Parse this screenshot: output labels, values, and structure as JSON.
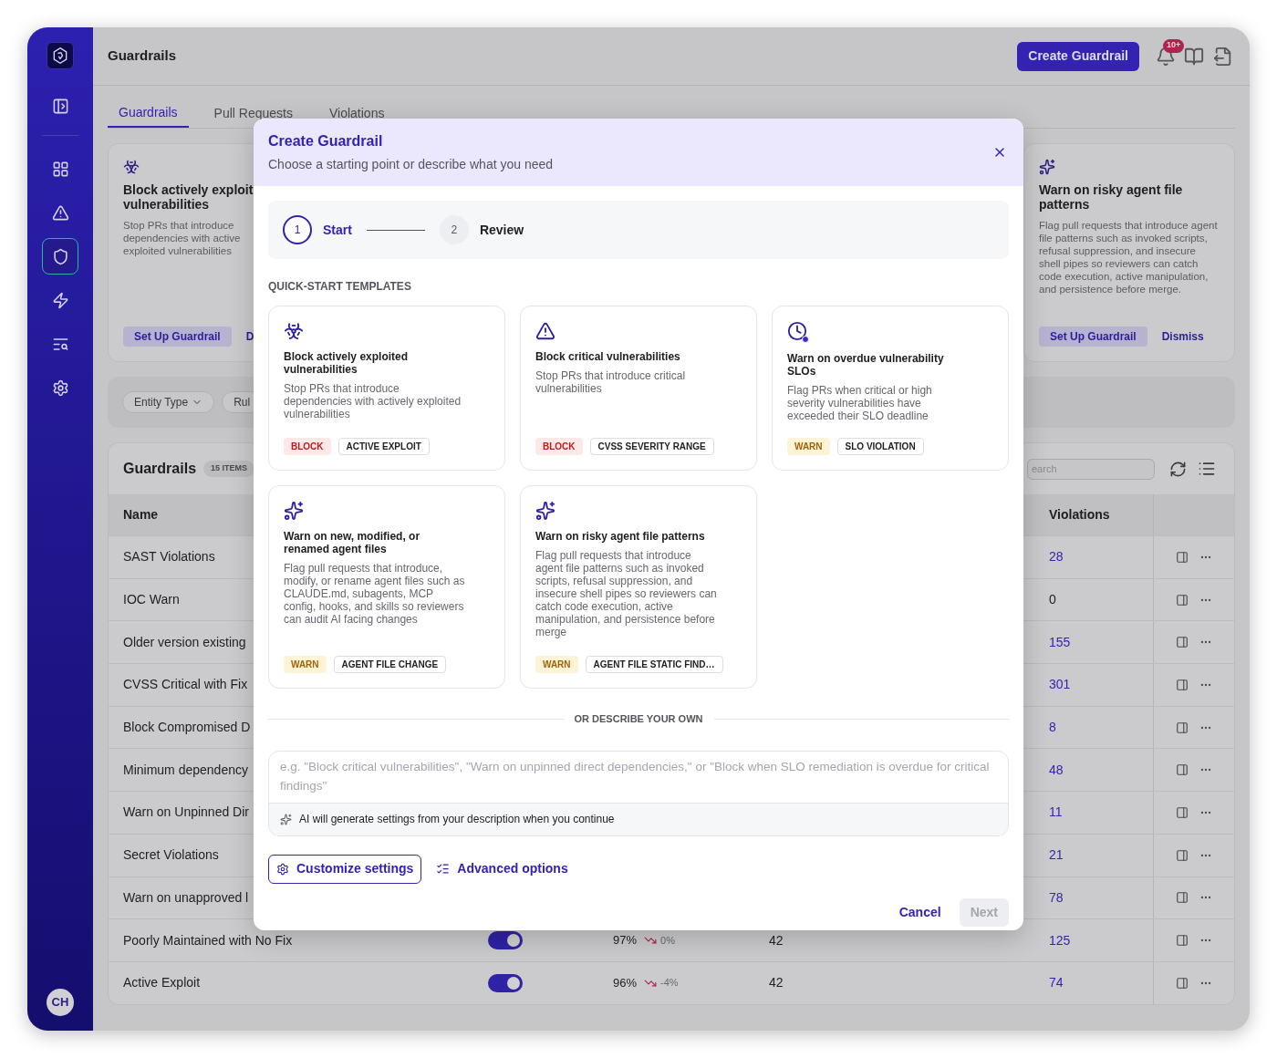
{
  "sidebar": {
    "items": [
      {
        "selected": false
      },
      {
        "selected": false
      },
      {
        "selected": false
      },
      {
        "selected": true
      },
      {
        "selected": false
      },
      {
        "selected": false
      },
      {
        "selected": false
      }
    ],
    "avatar": "CH"
  },
  "header": {
    "title": "Guardrails",
    "create_button": "Create Guardrail",
    "notification_badge": "10+"
  },
  "tabs": [
    {
      "label": "Guardrails",
      "selected": true
    },
    {
      "label": "Pull Requests",
      "selected": false
    },
    {
      "label": "Violations",
      "selected": false
    }
  ],
  "promo_cards": [
    {
      "kind": "exploit",
      "title": "Block actively exploit\nvulnerabilities",
      "description": "Stop PRs that introduce\ndependencies with active\nexploited vulnerabilities",
      "setup_button": "Set Up Guardrail",
      "dismiss_button": "D"
    },
    {
      "kind": "agent",
      "title": "Warn on risky agent file patterns",
      "description": "Flag pull requests that introduce agent file patterns such as invoked scripts, refusal suppression, and insecure shell pipes so reviewers can catch code execution, active manipulation, and persistence before merge.",
      "setup_button": "Set Up Guardrail",
      "dismiss_button": "Dismiss"
    }
  ],
  "filters": [
    {
      "label": "Entity Type",
      "kind": "dropdown"
    },
    {
      "label": "Rul",
      "kind": "plain"
    }
  ],
  "table": {
    "title": "Guardrails",
    "count": "15 ITEMS",
    "search": {
      "placeholder": "earch"
    },
    "columns": [
      "Name",
      "Violations"
    ],
    "rows": [
      {
        "name": "SAST Violations",
        "violations": "28",
        "link": true
      },
      {
        "name": "IOC Warn",
        "violations": "0",
        "link": false
      },
      {
        "name": "Older version existing",
        "violations": "155",
        "link": true
      },
      {
        "name": "CVSS Critical with Fix",
        "violations": "301",
        "link": true
      },
      {
        "name": "Block Compromised D",
        "violations": "8",
        "link": true
      },
      {
        "name": "Minimum dependency",
        "violations": "48",
        "link": true
      },
      {
        "name": "Warn on Unpinned Dir",
        "violations": "11",
        "link": true
      },
      {
        "name": "Secret Violations",
        "violations": "21",
        "link": true
      },
      {
        "name": "Warn on unapproved l",
        "violations": "78",
        "link": true
      },
      {
        "name": "Poorly Maintained with No Fix",
        "enabled": true,
        "score": "97%",
        "trend": "0%",
        "count": "42",
        "violations": "125",
        "link": true
      },
      {
        "name": "Active Exploit",
        "enabled": true,
        "score": "96%",
        "trend": "-4%",
        "count": "42",
        "violations": "74",
        "link": true
      }
    ]
  },
  "modal": {
    "title": "Create Guardrail",
    "subtitle": "Choose a starting point or describe what you need",
    "steps": [
      {
        "number": "1",
        "label": "Start",
        "selected": true
      },
      {
        "number": "2",
        "label": "Review",
        "selected": false
      }
    ],
    "section_label": "QUICK-START TEMPLATES",
    "templates": [
      {
        "kind": "exploit",
        "title": "Block actively exploited vulnerabilities",
        "description": "Stop PRs that introduce dependencies with actively exploited vulnerabilities",
        "action": {
          "label": "BLOCK",
          "kind": "block"
        },
        "category": "ACTIVE EXPLOIT"
      },
      {
        "kind": "severity",
        "title": "Block critical vulnerabilities",
        "description": "Stop PRs that introduce critical vulnerabilities",
        "action": {
          "label": "BLOCK",
          "kind": "block"
        },
        "category": "CVSS SEVERITY RANGE"
      },
      {
        "kind": "slo",
        "title": "Warn on overdue vulnerability SLOs",
        "description": "Flag PRs when critical or high severity vulnerabilities have exceeded their SLO deadline",
        "action": {
          "label": "WARN",
          "kind": "warn"
        },
        "category": "SLO VIOLATION"
      },
      {
        "kind": "agent",
        "title": "Warn on new, modified, or renamed agent files",
        "description": "Flag pull requests that introduce, modify, or rename agent files such as CLAUDE.md, subagents, MCP config, hooks, and skills so reviewers can audit AI facing changes",
        "action": {
          "label": "WARN",
          "kind": "warn"
        },
        "category": "AGENT FILE CHANGE"
      },
      {
        "kind": "agent",
        "title": "Warn on risky agent file patterns",
        "description": "Flag pull requests that introduce agent file patterns such as invoked scripts, refusal suppression, and insecure shell pipes so reviewers can catch code execution, active manipulation, and persistence before merge",
        "action": {
          "label": "WARN",
          "kind": "warn"
        },
        "category": "AGENT FILE STATIC FIND…"
      }
    ],
    "divider_label": "OR DESCRIBE YOUR OWN",
    "describe": {
      "placeholder": "e.g. \"Block critical vulnerabilities\", \"Warn on unpinned direct dependencies,\" or \"Block when SLO remediation is overdue for critical findings\"",
      "hint": "AI will generate settings from your description when you continue"
    },
    "customize_button": "Customize settings",
    "advanced_button": "Advanced options",
    "cancel_button": "Cancel",
    "next_button": {
      "label": "Next",
      "disabled": true
    }
  }
}
